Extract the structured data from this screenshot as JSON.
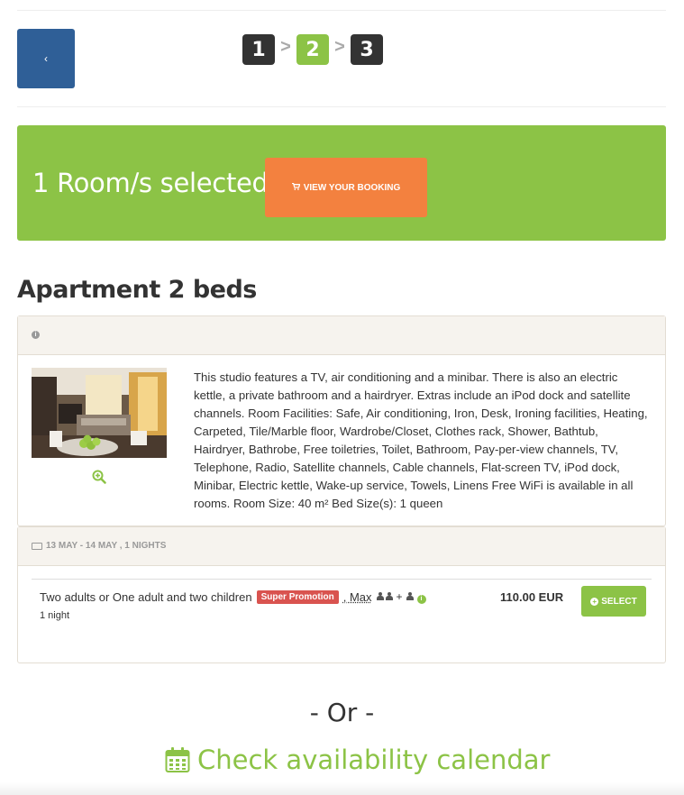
{
  "nav": {
    "back_label": "‹",
    "steps": [
      "1",
      "2",
      "3"
    ],
    "active_step": "2",
    "separator": ">"
  },
  "banner": {
    "title": "1 Room/s selected",
    "button_label": "VIEW YOUR BOOKING",
    "button_icon": "cart-icon"
  },
  "room": {
    "title": "Apartment 2 beds",
    "info_icon": "info-icon",
    "zoom_icon": "zoom-in-icon",
    "description": "This studio features a TV, air conditioning and a minibar. There is also an electric kettle, a private bathroom and a hairdryer. Extras include an iPod dock and satellite channels. Room Facilities: Safe, Air conditioning, Iron, Desk, Ironing facilities, Heating, Carpeted, Tile/Marble floor, Wardrobe/Closet, Clothes rack, Shower, Bathtub, Hairdryer, Bathrobe, Free toiletries, Toilet, Bathroom, Pay-per-view channels, TV, Telephone, Radio, Satellite channels, Cable channels, Flat-screen TV, iPod dock, Minibar, Electric kettle, Wake-up service, Towels, Linens Free WiFi is available in all rooms. Room Size: 40 m² Bed Size(s): 1 queen"
  },
  "rates": {
    "dates": "13 MAY - 14 MAY , 1 NIGHTS",
    "rows": [
      {
        "occupancy": "Two adults or One adult and two children",
        "badge": "Super Promotion",
        "max_label": ", Max",
        "plus": "+",
        "nights": "1 night",
        "price": "110.00 EUR",
        "select_label": "SELECT"
      }
    ]
  },
  "footer": {
    "or_text": "- Or -",
    "calendar_link": "Check availability calendar",
    "calendar_icon": "calendar-icon"
  },
  "colors": {
    "green": "#8cc346",
    "orange": "#f3813f",
    "blue": "#2f5f97",
    "dark": "#333333",
    "promo_red": "#d9534f"
  }
}
